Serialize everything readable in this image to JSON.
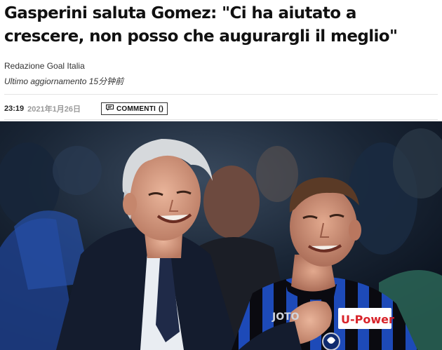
{
  "article": {
    "title": "Gasperini saluta Gomez: \"Ci ha aiutato a crescere, non posso che augurargli il meglio\"",
    "author": "Redazione Goal Italia",
    "updated": "Ultimo aggiornamento 15分钟前",
    "time": "23:19",
    "date": "2021年1月26日",
    "comments_label": "COMMENTI",
    "comments_count": "()"
  },
  "photo": {
    "jersey_brand": "JOTO",
    "sponsor": "U-Power",
    "colors": {
      "atalanta_blue": "#1c4ab5",
      "atalanta_black": "#0a0a0f",
      "sponsor_red": "#d8232a"
    }
  }
}
